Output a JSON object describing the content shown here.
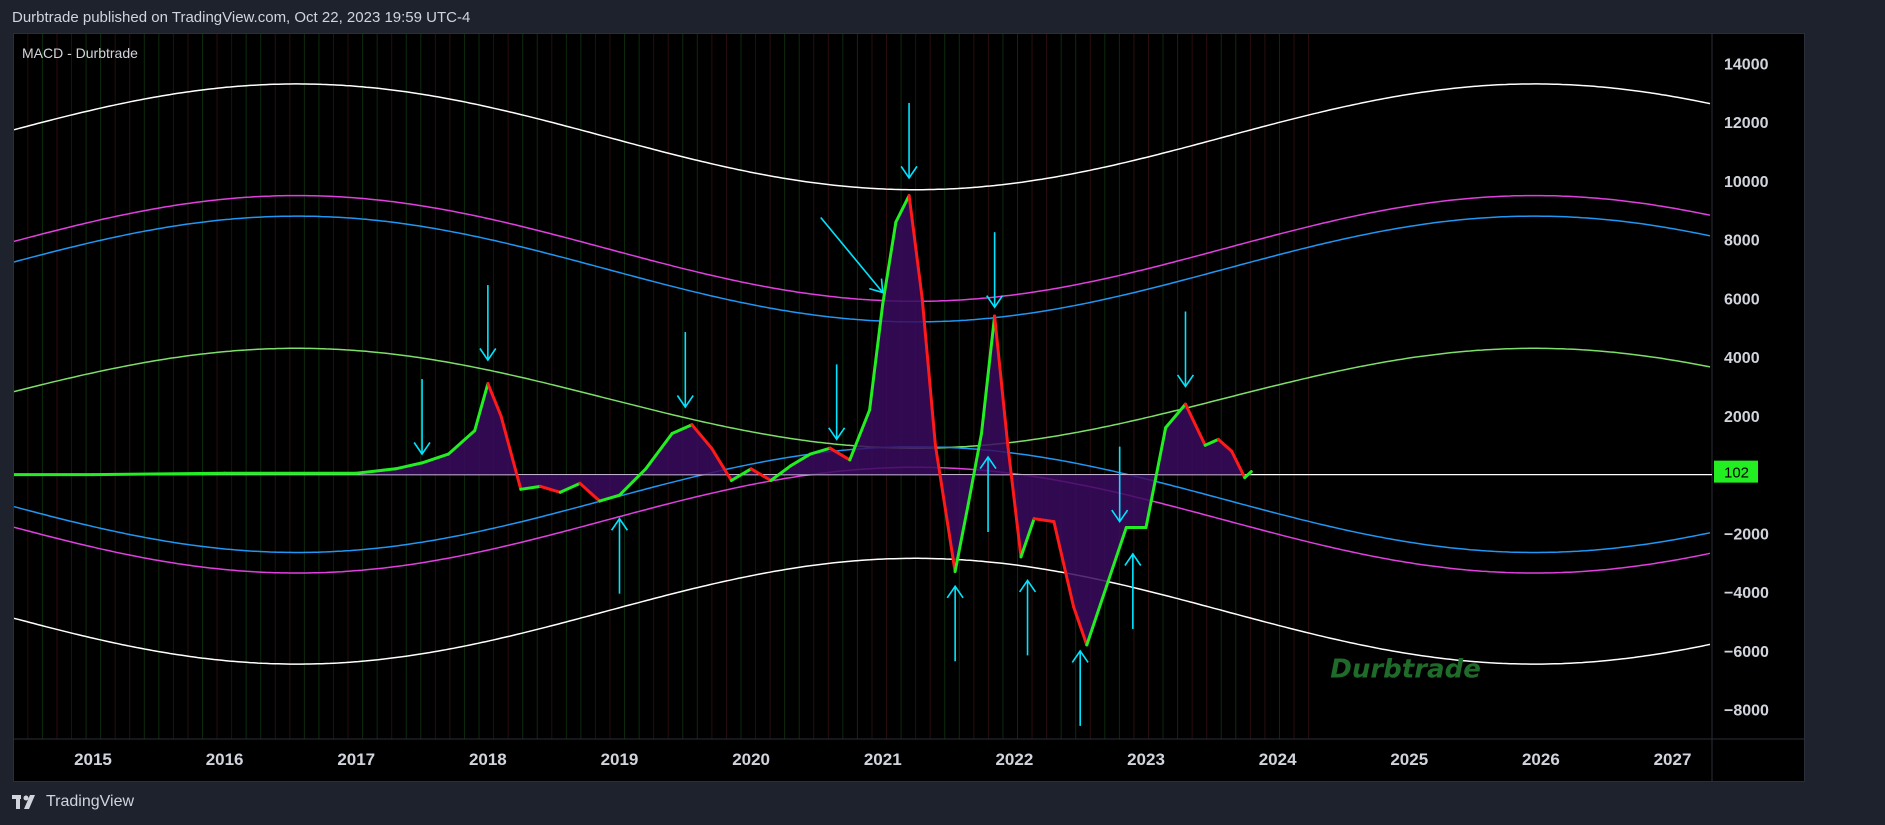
{
  "header": {
    "published": "Durbtrade published on TradingView.com, Oct 22, 2023 19:59 UTC-4"
  },
  "indicator": {
    "label": "MACD - Durbtrade"
  },
  "footer": {
    "brand": "TradingView"
  },
  "watermark": {
    "text": "Durbtrade"
  },
  "colors": {
    "background": "#000000",
    "outer_band": "#ffffff",
    "magenta_band": "#e040e0",
    "blue_band": "#2196f3",
    "green_band": "#7ddf6a",
    "macd_up": "#22ee22",
    "macd_down": "#ff1a1a",
    "fill_positive": "#3a0a5e",
    "fill_negative": "#0a0a5e",
    "arrows": "#00e5ff",
    "last_value_badge": "#22ee22"
  },
  "chart_data": {
    "type": "line",
    "title": "MACD - Durbtrade",
    "xlim": [
      2014.4,
      2027.3
    ],
    "ylim": [
      -9000,
      15000
    ],
    "x_ticks": [
      2015,
      2016,
      2017,
      2018,
      2019,
      2020,
      2021,
      2022,
      2023,
      2024,
      2025,
      2026,
      2027
    ],
    "x_tick_labels": [
      "2015",
      "2016",
      "2017",
      "2018",
      "2019",
      "2020",
      "2021",
      "2022",
      "2023",
      "2024",
      "2025",
      "2026",
      "2027"
    ],
    "y_ticks": [
      14000,
      12000,
      10000,
      8000,
      6000,
      4000,
      2000,
      -2000,
      -4000,
      -6000,
      -8000
    ],
    "y_tick_labels": [
      "14000",
      "12000",
      "10000",
      "8000",
      "6000",
      "4000",
      "2000",
      "−2000",
      "−4000",
      "−6000",
      "−8000"
    ],
    "last_value": "102",
    "bands": {
      "center_year": 2021.25,
      "period_years": 9.4,
      "outer": {
        "base": 3500,
        "amplitude": 9800
      },
      "magenta": {
        "base": 3000,
        "amplitude": 6600
      },
      "blue": {
        "base": 3000,
        "amplitude": 5900
      },
      "green": {
        "base": 2600,
        "amplitude": 1800
      },
      "blue_lower": {
        "base": -800,
        "amplitude": -1900
      },
      "magenta_lower": {
        "base": -1500,
        "amplitude": -1900
      },
      "outer_lower": {
        "base": -4500,
        "amplitude": -1900
      }
    },
    "series": [
      {
        "name": "MACD",
        "x": [
          2014.4,
          2015.0,
          2016.0,
          2017.0,
          2017.3,
          2017.5,
          2017.7,
          2017.9,
          2018.0,
          2018.1,
          2018.25,
          2018.4,
          2018.55,
          2018.7,
          2018.85,
          2019.0,
          2019.2,
          2019.4,
          2019.55,
          2019.7,
          2019.85,
          2020.0,
          2020.15,
          2020.3,
          2020.45,
          2020.6,
          2020.75,
          2020.9,
          2021.0,
          2021.1,
          2021.2,
          2021.3,
          2021.4,
          2021.55,
          2021.65,
          2021.75,
          2021.85,
          2021.95,
          2022.05,
          2022.15,
          2022.3,
          2022.45,
          2022.55,
          2022.7,
          2022.85,
          2023.0,
          2023.15,
          2023.3,
          2023.45,
          2023.55,
          2023.65,
          2023.75,
          2023.8
        ],
        "values": [
          0,
          0,
          50,
          50,
          200,
          400,
          700,
          1500,
          3100,
          2000,
          -500,
          -400,
          -600,
          -300,
          -900,
          -700,
          200,
          1400,
          1700,
          900,
          -200,
          200,
          -200,
          300,
          700,
          900,
          500,
          2200,
          5800,
          8600,
          9500,
          6000,
          1000,
          -3300,
          -1000,
          1400,
          5400,
          1000,
          -2800,
          -1500,
          -1600,
          -4500,
          -5800,
          -3800,
          -1800,
          -1800,
          1600,
          2400,
          1000,
          1200,
          800,
          -100,
          102
        ]
      }
    ],
    "arrows": [
      {
        "x": 2017.5,
        "direction": "down",
        "tip": 700
      },
      {
        "x": 2018.0,
        "direction": "down",
        "tip": 3900
      },
      {
        "x": 2019.5,
        "direction": "down",
        "tip": 2300
      },
      {
        "x": 2020.65,
        "direction": "down",
        "tip": 1200
      },
      {
        "x": 2021.2,
        "direction": "down",
        "tip": 10100
      },
      {
        "x": 2021.85,
        "direction": "down",
        "tip": 5700
      },
      {
        "x": 2023.3,
        "direction": "down",
        "tip": 3000
      },
      {
        "x": 2022.8,
        "direction": "down",
        "tip": -1600
      },
      {
        "x": 2019.0,
        "direction": "up",
        "tip": -1500
      },
      {
        "x": 2021.55,
        "direction": "up",
        "tip": -3800
      },
      {
        "x": 2021.8,
        "direction": "up",
        "tip": 600
      },
      {
        "x": 2022.1,
        "direction": "up",
        "tip": -3600
      },
      {
        "x": 2022.5,
        "direction": "up",
        "tip": -6000
      },
      {
        "x": 2022.9,
        "direction": "up",
        "tip": -2700
      },
      {
        "x": 2021.0,
        "direction": "diagonal",
        "tip": 6200
      }
    ]
  }
}
